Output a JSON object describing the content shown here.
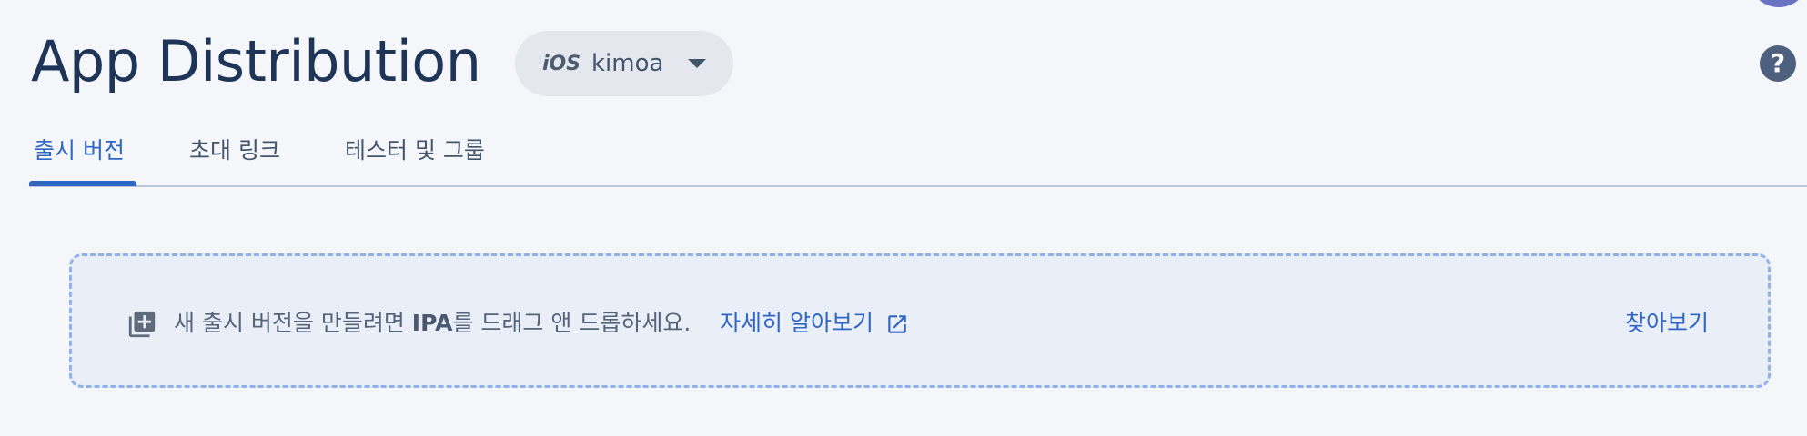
{
  "header": {
    "title": "App Distribution",
    "platform_chip": {
      "platform_label": "iOS",
      "app_name": "kimoa",
      "caret_icon": "arrow-drop-down-icon"
    },
    "help_icon": "help-icon",
    "help_glyph": "?"
  },
  "tabs": [
    {
      "label": "출시 버전",
      "active": true
    },
    {
      "label": "초대 링크",
      "active": false
    },
    {
      "label": "테스터 및 그룹",
      "active": false
    }
  ],
  "dropzone": {
    "icon": "add-to-queue-icon",
    "text_before": "새 출시 버전을 만들려면 ",
    "text_bold": "IPA",
    "text_after": "를 드래그 앤 드롭하세요.",
    "learn_more": "자세히 알아보기",
    "external_icon": "open-in-new-icon",
    "browse": "찾아보기"
  },
  "colors": {
    "accent": "#2f66c4",
    "title": "#1f3557",
    "dropzone_border": "#8fb2e8",
    "dropzone_bg": "#eaeef7",
    "page_bg": "#f5f6f9"
  }
}
